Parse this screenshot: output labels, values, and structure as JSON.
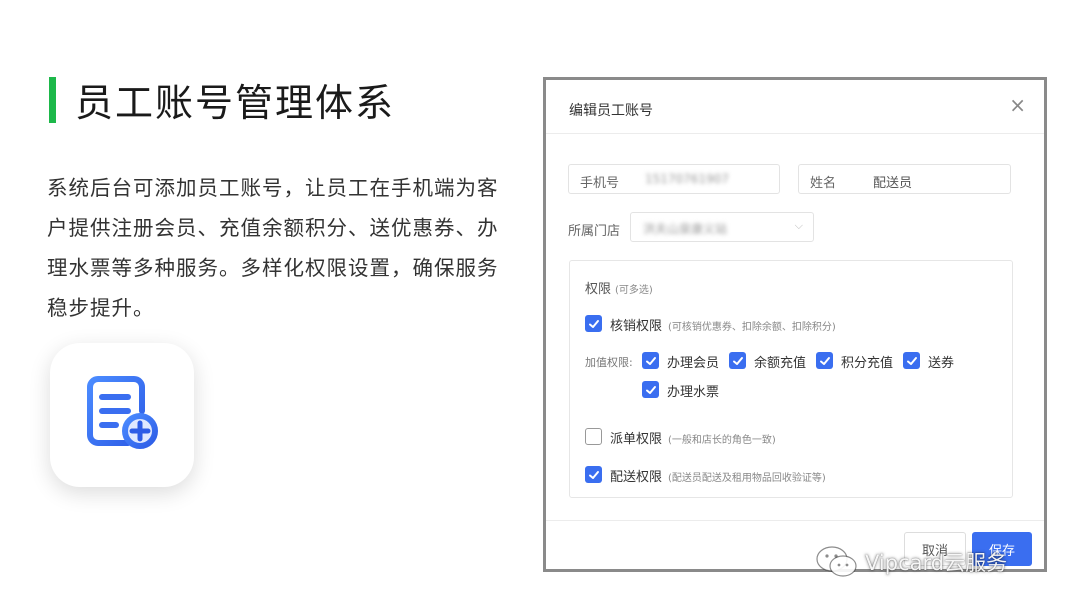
{
  "left": {
    "title": "员工账号管理体系",
    "description": "系统后台可添加员工账号，让员工在手机端为客户提供注册会员、充值余额积分、送优惠券、办理水票等多种服务。多样化权限设置，确保服务稳步提升。",
    "app_icon": "document-add-icon"
  },
  "dialog": {
    "title": "编辑员工账号",
    "close": "×",
    "phone_label": "手机号",
    "phone_value": "15170761907",
    "name_label": "姓名",
    "name_value": "配送员",
    "store_label": "所属门店",
    "store_value": "洪夫山泉康义站",
    "permissions": {
      "title": "权限",
      "title_note": "(可多选)",
      "writeoff": {
        "label": "核销权限",
        "note": "(可核销优惠券、扣除余额、扣除积分)",
        "checked": true
      },
      "add_value_label": "加值权限:",
      "add_value_items": [
        {
          "label": "办理会员",
          "checked": true
        },
        {
          "label": "余额充值",
          "checked": true
        },
        {
          "label": "积分充值",
          "checked": true
        },
        {
          "label": "送券",
          "checked": true
        },
        {
          "label": "办理水票",
          "checked": true
        }
      ],
      "dispatch": {
        "label": "派单权限",
        "note": "(一般和店长的角色一致)",
        "checked": false
      },
      "delivery": {
        "label": "配送权限",
        "note": "(配送员配送及租用物品回收验证等)",
        "checked": true
      }
    },
    "cancel_label": "取消",
    "save_label": "保存"
  },
  "watermark": {
    "text": "Vipcard云服务"
  },
  "colors": {
    "accent": "#3a6ef0",
    "title_bar": "#1db84a"
  }
}
